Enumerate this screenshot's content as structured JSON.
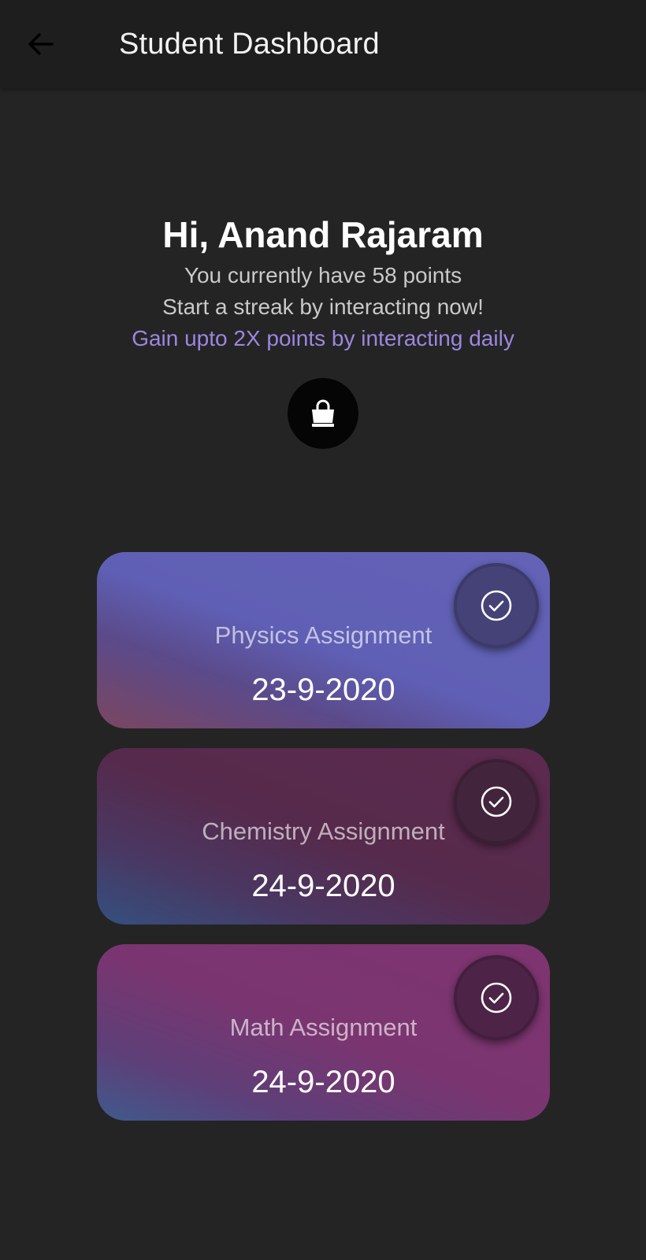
{
  "app_bar": {
    "title": "Student Dashboard",
    "back_icon": "arrow-left-icon"
  },
  "header": {
    "greeting": "Hi, Anand Rajaram",
    "points_text": "You currently have 58 points",
    "streak_text": "Start a streak by interacting now!",
    "bonus_text": "Gain upto 2X points by interacting daily",
    "shop_icon": "shopping-bag-icon"
  },
  "assignments": [
    {
      "title": "Physics Assignment",
      "date": "23-9-2020",
      "status_icon": "check-circle-icon"
    },
    {
      "title": "Chemistry Assignment",
      "date": "24-9-2020",
      "status_icon": "check-circle-icon"
    },
    {
      "title": "Math Assignment",
      "date": "24-9-2020",
      "status_icon": "check-circle-icon"
    }
  ],
  "colors": {
    "background": "#242424",
    "app_bar": "#1e1e1e",
    "accent_text": "#9c86e0",
    "physics_card": "#6462b6",
    "chemistry_card": "#562a4c",
    "math_card": "#7f3470"
  }
}
